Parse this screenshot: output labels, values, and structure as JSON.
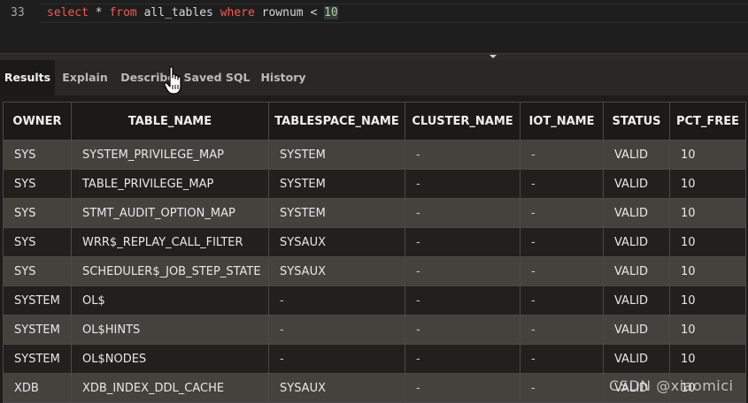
{
  "editor": {
    "line_number": "33",
    "code": {
      "kw1": "select",
      "p1": " * ",
      "kw2": "from",
      "p2": " all_tables ",
      "kw3": "where",
      "p3": " rownum < ",
      "num": "10"
    }
  },
  "tabs": [
    {
      "label": "Results",
      "active": true
    },
    {
      "label": "Explain"
    },
    {
      "label": "Describe"
    },
    {
      "label": "Saved SQL"
    },
    {
      "label": "History"
    }
  ],
  "table": {
    "columns": [
      "OWNER",
      "TABLE_NAME",
      "TABLESPACE_NAME",
      "CLUSTER_NAME",
      "IOT_NAME",
      "STATUS",
      "PCT_FREE"
    ],
    "rows": [
      [
        "SYS",
        "SYSTEM_PRIVILEGE_MAP",
        "SYSTEM",
        "-",
        "-",
        "VALID",
        "10"
      ],
      [
        "SYS",
        "TABLE_PRIVILEGE_MAP",
        "SYSTEM",
        "-",
        "-",
        "VALID",
        "10"
      ],
      [
        "SYS",
        "STMT_AUDIT_OPTION_MAP",
        "SYSTEM",
        "-",
        "-",
        "VALID",
        "10"
      ],
      [
        "SYS",
        "WRR$_REPLAY_CALL_FILTER",
        "SYSAUX",
        "-",
        "-",
        "VALID",
        "10"
      ],
      [
        "SYS",
        "SCHEDULER$_JOB_STEP_STATE",
        "SYSAUX",
        "-",
        "-",
        "VALID",
        "10"
      ],
      [
        "SYSTEM",
        "OL$",
        "-",
        "-",
        "-",
        "VALID",
        "10"
      ],
      [
        "SYSTEM",
        "OL$HINTS",
        "-",
        "-",
        "-",
        "VALID",
        "10"
      ],
      [
        "SYSTEM",
        "OL$NODES",
        "-",
        "-",
        "-",
        "VALID",
        "10"
      ],
      [
        "XDB",
        "XDB_INDEX_DDL_CACHE",
        "SYSAUX",
        "-",
        "-",
        "VALID",
        "10"
      ]
    ]
  },
  "watermark": "CSDN @xiaomici",
  "colors": {
    "keyword": "#f25a50",
    "number": "#b5cea8",
    "row_odd": "#45413d",
    "row_even": "#221f1d"
  },
  "icons": {
    "cursor": "hand-pointer-icon",
    "splitter": "drag-handle-icon"
  }
}
